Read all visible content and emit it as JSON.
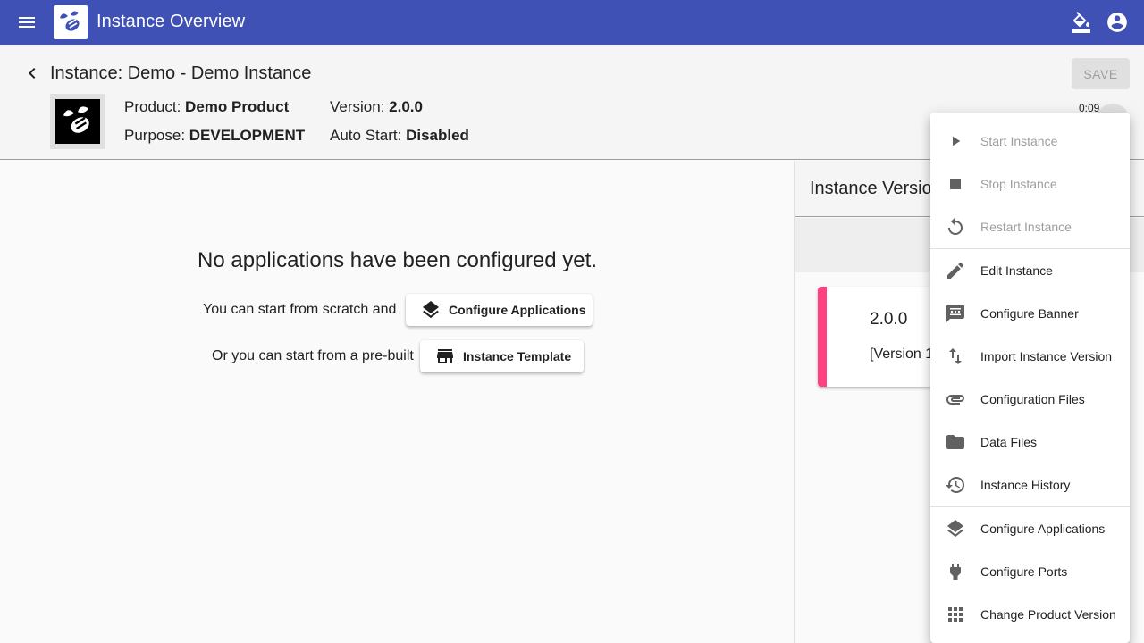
{
  "toolbar": {
    "title": "Instance Overview",
    "color": "#3f51b5",
    "icons": [
      "menu-icon",
      "logo",
      "theme-icon",
      "account-icon"
    ]
  },
  "header": {
    "instance_title": "Instance: Demo - Demo Instance",
    "product_label": "Product:",
    "product_value": "Demo Product",
    "purpose_label": "Purpose:",
    "purpose_value": "DEVELOPMENT",
    "version_label": "Version:",
    "version_value": "2.0.0",
    "autostart_label": "Auto Start:",
    "autostart_value": "Disabled",
    "save_label": "SAVE",
    "timer": "0:09"
  },
  "main": {
    "empty_title": "No applications have been configured yet.",
    "scratch_text": "You can start from scratch and",
    "configure_apps_label": "Configure Applications",
    "template_text": "Or you can start from a pre-built",
    "template_label": "Instance Template"
  },
  "side": {
    "title": "Instance Versions",
    "version_number": "2.0.0",
    "version_desc": "[Version 1]",
    "accent": "#ff4081"
  },
  "menu": {
    "items": [
      {
        "label": "Start Instance",
        "icon": "play-icon",
        "disabled": true
      },
      {
        "label": "Stop Instance",
        "icon": "stop-icon",
        "disabled": true
      },
      {
        "label": "Restart Instance",
        "icon": "replay-icon",
        "disabled": true
      },
      {
        "label": "Edit Instance",
        "icon": "edit-icon",
        "disabled": false
      },
      {
        "label": "Configure Banner",
        "icon": "comment-icon",
        "disabled": false
      },
      {
        "label": "Import Instance Version",
        "icon": "import-export-icon",
        "disabled": false
      },
      {
        "label": "Configuration Files",
        "icon": "attachment-icon",
        "disabled": false
      },
      {
        "label": "Data Files",
        "icon": "folder-icon",
        "disabled": false
      },
      {
        "label": "Instance History",
        "icon": "history-icon",
        "disabled": false
      },
      {
        "label": "Configure Applications",
        "icon": "layers-icon",
        "disabled": false
      },
      {
        "label": "Configure Ports",
        "icon": "plug-icon",
        "disabled": false
      },
      {
        "label": "Change Product Version",
        "icon": "apps-icon",
        "disabled": false
      }
    ]
  }
}
